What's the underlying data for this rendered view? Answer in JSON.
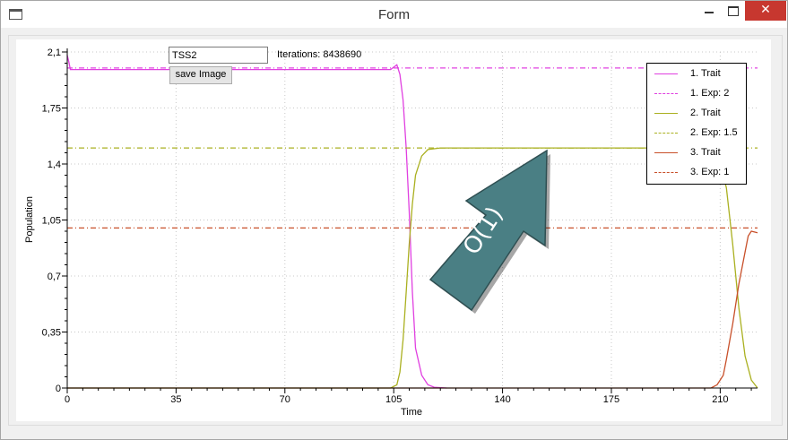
{
  "window": {
    "title": "Form",
    "close_glyph": "✕"
  },
  "controls": {
    "input_value": "TSS2",
    "iterations_label": "Iterations: 8438690",
    "save_button_label": "save Image"
  },
  "annotation": {
    "text": "O(1)",
    "color": "#4a7f84"
  },
  "legend": {
    "items": [
      {
        "label": "1. Trait",
        "color": "#e040e0",
        "style": "solid"
      },
      {
        "label": "1. Exp: 2",
        "color": "#e040e0",
        "style": "dashdot"
      },
      {
        "label": "2. Trait",
        "color": "#aab020",
        "style": "solid"
      },
      {
        "label": "2. Exp: 1.5",
        "color": "#aab020",
        "style": "dashdot"
      },
      {
        "label": "3. Trait",
        "color": "#c8502a",
        "style": "solid"
      },
      {
        "label": "3. Exp: 1",
        "color": "#c8502a",
        "style": "dashdot"
      }
    ]
  },
  "chart_data": {
    "type": "line",
    "xlabel": "Time",
    "ylabel": "Population",
    "xlim": [
      0,
      222
    ],
    "ylim": [
      0,
      2.1
    ],
    "x_ticks": [
      "0",
      "35",
      "70",
      "105",
      "140",
      "175",
      "210"
    ],
    "x_tick_values": [
      0,
      35,
      70,
      105,
      140,
      175,
      210
    ],
    "y_ticks": [
      "0",
      "0,35",
      "0,7",
      "1,05",
      "1,4",
      "1,75",
      "2,1"
    ],
    "y_tick_values": [
      0,
      0.35,
      0.7,
      1.05,
      1.4,
      1.75,
      2.1
    ],
    "grid": true,
    "series": [
      {
        "name": "1. Trait",
        "color": "#e040e0",
        "style": "solid",
        "x": [
          0,
          0.5,
          1,
          2,
          104,
          106,
          107,
          108,
          109,
          110,
          111,
          112,
          114,
          116,
          118,
          122
        ],
        "y": [
          2.08,
          2.04,
          1.99,
          1.99,
          1.99,
          2.02,
          1.96,
          1.8,
          1.5,
          1.1,
          0.6,
          0.25,
          0.08,
          0.02,
          0.005,
          0
        ]
      },
      {
        "name": "1. Exp: 2",
        "color": "#e040e0",
        "style": "dashdot",
        "x": [
          0,
          222
        ],
        "y": [
          2.0,
          2.0
        ]
      },
      {
        "name": "2. Trait",
        "color": "#aab020",
        "style": "solid",
        "x": [
          0,
          104,
          106,
          107,
          108,
          109,
          110,
          111,
          112,
          114,
          116,
          120,
          130,
          207,
          208,
          210,
          212,
          214,
          216,
          218,
          220,
          222
        ],
        "y": [
          0,
          0,
          0.02,
          0.1,
          0.3,
          0.6,
          0.9,
          1.15,
          1.33,
          1.45,
          1.49,
          1.5,
          1.5,
          1.5,
          1.48,
          1.42,
          1.25,
          0.9,
          0.5,
          0.2,
          0.05,
          0
        ]
      },
      {
        "name": "2. Exp: 1.5",
        "color": "#aab020",
        "style": "dashdot",
        "x": [
          0,
          222
        ],
        "y": [
          1.5,
          1.5
        ]
      },
      {
        "name": "3. Trait",
        "color": "#c8502a",
        "style": "solid",
        "x": [
          0,
          207,
          209,
          211,
          212,
          214,
          216,
          218,
          219,
          220,
          222
        ],
        "y": [
          0,
          0,
          0.02,
          0.08,
          0.18,
          0.4,
          0.65,
          0.85,
          0.95,
          0.98,
          0.97
        ]
      },
      {
        "name": "3. Exp: 1",
        "color": "#c8502a",
        "style": "dashdot",
        "x": [
          0,
          222
        ],
        "y": [
          1.0,
          1.0
        ]
      }
    ]
  }
}
